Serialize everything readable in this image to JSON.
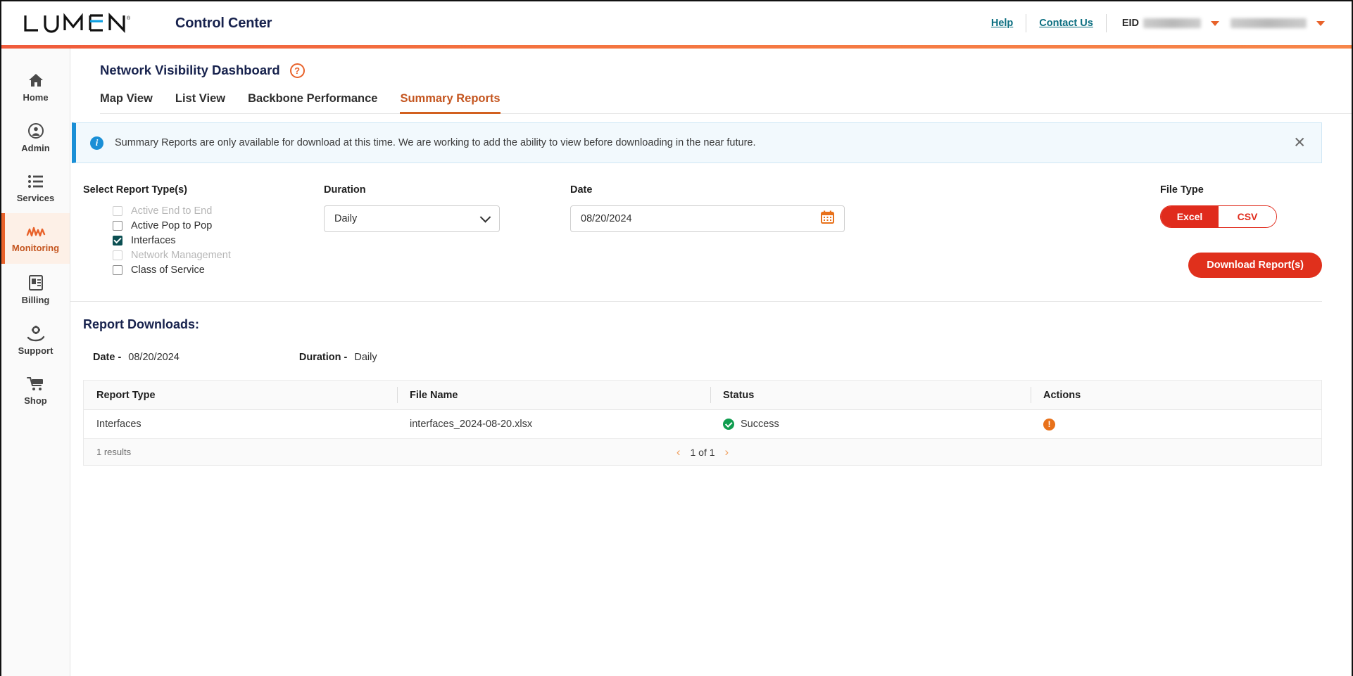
{
  "header": {
    "brand": "LUMEN",
    "app_title": "Control Center",
    "help_label": "Help",
    "contact_label": "Contact Us",
    "eid_label": "EID",
    "eid_value": "",
    "account_value": ""
  },
  "sidebar": {
    "items": [
      {
        "label": "Home",
        "icon": "home-icon",
        "active": false
      },
      {
        "label": "Admin",
        "icon": "user-circle-icon",
        "active": false
      },
      {
        "label": "Services",
        "icon": "list-icon",
        "active": false
      },
      {
        "label": "Monitoring",
        "icon": "activity-icon",
        "active": true
      },
      {
        "label": "Billing",
        "icon": "invoice-icon",
        "active": false
      },
      {
        "label": "Support",
        "icon": "support-hand-icon",
        "active": false
      },
      {
        "label": "Shop",
        "icon": "cart-icon",
        "active": false
      }
    ]
  },
  "page": {
    "title": "Network Visibility Dashboard",
    "help_icon": "question-mark-icon",
    "tabs": [
      {
        "label": "Map View",
        "active": false
      },
      {
        "label": "List View",
        "active": false
      },
      {
        "label": "Backbone Performance",
        "active": false
      },
      {
        "label": "Summary Reports",
        "active": true
      }
    ]
  },
  "banner": {
    "icon": "info-icon",
    "text": "Summary Reports are only available for download at this time. We are working to add the ability to view before downloading in the near future.",
    "close_icon": "close-icon"
  },
  "filters": {
    "report_types_label": "Select Report Type(s)",
    "report_types": [
      {
        "label": "Active End to End",
        "checked": false,
        "disabled": true
      },
      {
        "label": "Active Pop to Pop",
        "checked": false,
        "disabled": false
      },
      {
        "label": "Interfaces",
        "checked": true,
        "disabled": false
      },
      {
        "label": "Network Management",
        "checked": false,
        "disabled": true
      },
      {
        "label": "Class of Service",
        "checked": false,
        "disabled": false
      }
    ],
    "duration_label": "Duration",
    "duration_value": "Daily",
    "duration_options": [
      "Daily"
    ],
    "date_label": "Date",
    "date_value": "08/20/2024",
    "calendar_icon": "calendar-icon",
    "file_type_label": "File Type",
    "file_type_options": [
      {
        "label": "Excel",
        "selected": true
      },
      {
        "label": "CSV",
        "selected": false
      }
    ],
    "download_label": "Download Report(s)"
  },
  "reports": {
    "section_title": "Report Downloads:",
    "date_key": "Date -",
    "date_value": "08/20/2024",
    "duration_key": "Duration -",
    "duration_value": "Daily",
    "columns": [
      "Report Type",
      "File Name",
      "Status",
      "Actions"
    ],
    "rows": [
      {
        "report_type": "Interfaces",
        "file_name": "interfaces_2024-08-20.xlsx",
        "status": "Success",
        "status_icon": "check-circle-icon",
        "action_icon": "alert-circle-icon"
      }
    ],
    "results_text": "1 results",
    "page_text": "1 of 1",
    "prev_icon": "chevron-left-icon",
    "next_icon": "chevron-right-icon"
  },
  "colors": {
    "brand_orange": "#e8622a",
    "action_red": "#e0301c",
    "link_teal": "#0b6e80",
    "info_blue": "#1a8fd6",
    "success_green": "#0f9d4f",
    "checkbox_teal": "#0b4f52"
  }
}
